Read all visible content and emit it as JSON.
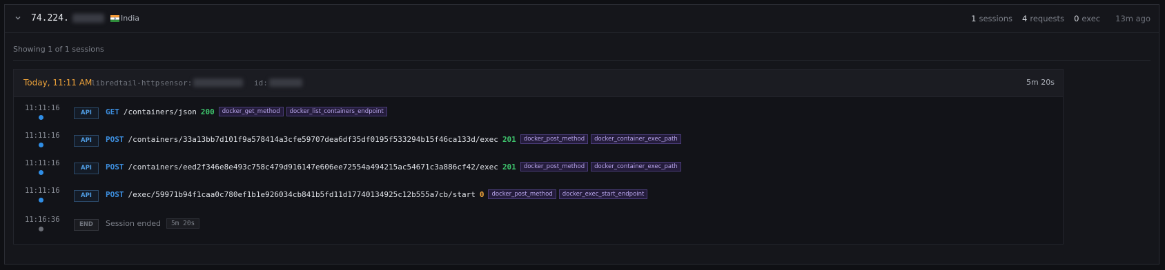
{
  "header": {
    "ip_visible": "74.224.",
    "country": "India",
    "stats": {
      "sessions_count": "1",
      "sessions_label": "sessions",
      "requests_count": "4",
      "requests_label": "requests",
      "exec_count": "0",
      "exec_label": "exec",
      "ago": "13m ago"
    }
  },
  "showing_text": "Showing 1 of 1 sessions",
  "session": {
    "date": "Today, 11:11 AM",
    "source": "libredtail-http",
    "sensor_label": "sensor:",
    "id_label": "id:",
    "duration": "5m 20s",
    "events": [
      {
        "time": "11:11:16",
        "badge": "API",
        "method": "GET",
        "path": "/containers/json",
        "status": "200",
        "tags": [
          "docker_get_method",
          "docker_list_containers_endpoint"
        ]
      },
      {
        "time": "11:11:16",
        "badge": "API",
        "method": "POST",
        "path": "/containers/33a13bb7d101f9a578414a3cfe59707dea6df35df0195f533294b15f46ca133d/exec",
        "status": "201",
        "tags": [
          "docker_post_method",
          "docker_container_exec_path"
        ]
      },
      {
        "time": "11:11:16",
        "badge": "API",
        "method": "POST",
        "path": "/containers/eed2f346e8e493c758c479d916147e606ee72554a494215ac54671c3a886cf42/exec",
        "status": "201",
        "tags": [
          "docker_post_method",
          "docker_container_exec_path"
        ]
      },
      {
        "time": "11:11:16",
        "badge": "API",
        "method": "POST",
        "path": "/exec/59971b94f1caa0c780ef1b1e926034cb841b5fd11d17740134925c12b555a7cb/start",
        "status": "0",
        "tags": [
          "docker_post_method",
          "docker_exec_start_endpoint"
        ]
      }
    ],
    "end_event": {
      "time": "11:16:36",
      "badge": "END",
      "label": "Session ended",
      "duration": "5m 20s"
    }
  },
  "colors": {
    "status_2xx": "#3ec46d",
    "status_other": "#f0a43a",
    "dot_active": "#2f8ee6",
    "dot_end": "#6a6d75"
  },
  "icons": {
    "collapse": "chevron-down-icon",
    "flag": "india-flag-icon"
  }
}
